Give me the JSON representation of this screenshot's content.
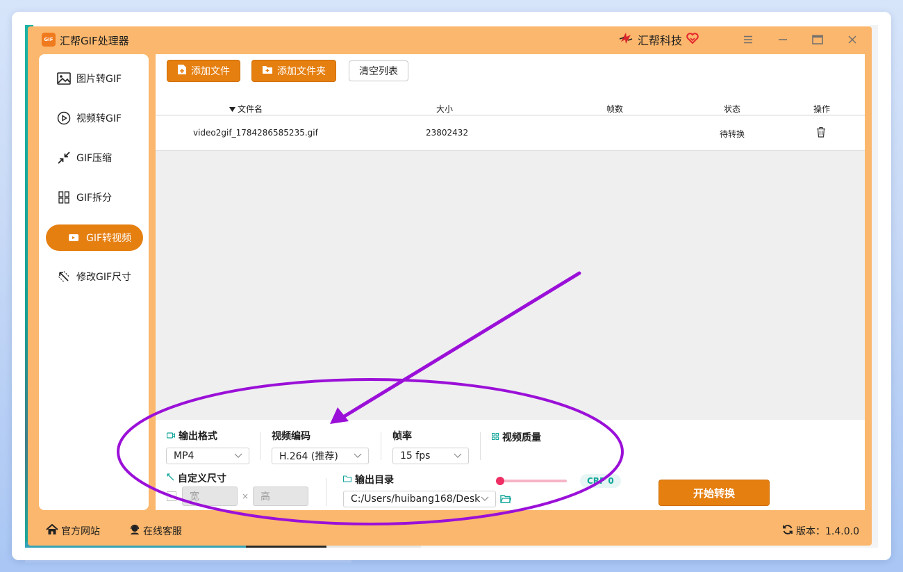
{
  "app": {
    "title": "汇帮GIF处理器",
    "logo_text": "GIF",
    "brand": "汇帮科技",
    "version_label": "版本：1.4.0.0"
  },
  "window_controls": {
    "menu_icon": "menu-icon",
    "minimize_icon": "minimize-icon",
    "maximize_icon": "maximize-icon",
    "close_icon": "close-icon"
  },
  "sidebar": {
    "items": [
      {
        "label": "图片转GIF",
        "icon": "image-icon",
        "active": false
      },
      {
        "label": "视频转GIF",
        "icon": "play-circle-icon",
        "active": false
      },
      {
        "label": "GIF压缩",
        "icon": "compress-icon",
        "active": false
      },
      {
        "label": "GIF拆分",
        "icon": "split-icon",
        "active": false
      },
      {
        "label": "GIF转视频",
        "icon": "video-icon",
        "active": true
      },
      {
        "label": "修改GIF尺寸",
        "icon": "resize-icon",
        "active": false
      }
    ]
  },
  "toolbar": {
    "add_file": "添加文件",
    "add_folder": "添加文件夹",
    "clear_list": "清空列表"
  },
  "table": {
    "columns": [
      "文件名",
      "大小",
      "帧数",
      "状态",
      "操作"
    ],
    "rows": [
      {
        "filename": "video2gif_1784286585235.gif",
        "size": "23802432",
        "frames": "",
        "status": "待转换",
        "action_icon": "trash-icon"
      }
    ]
  },
  "settings": {
    "output_format_label": "输出格式",
    "output_format_value": "MP4",
    "video_codec_label": "视频编码",
    "video_codec_value": "H.264 (推荐)",
    "framerate_label": "帧率",
    "framerate_value": "15 fps",
    "quality_label": "视频质量",
    "quality_badge": "CRF 0",
    "quality_level": 0,
    "custom_size_label": "自定义尺寸",
    "width_placeholder": "宽",
    "height_placeholder": "高",
    "times_sign": "×",
    "output_dir_label": "输出目录",
    "output_dir_value": "C:/Users/huibang168/Desk",
    "start_button": "开始转换"
  },
  "statusbar": {
    "website": "官方网站",
    "support": "在线客服"
  },
  "colors": {
    "accent_orange": "#e57f10",
    "window_bg": "#fbb76d",
    "annotation_purple": "#9b10d8",
    "slider_knob": "#ef2e64",
    "crf_text": "#12a59a"
  }
}
